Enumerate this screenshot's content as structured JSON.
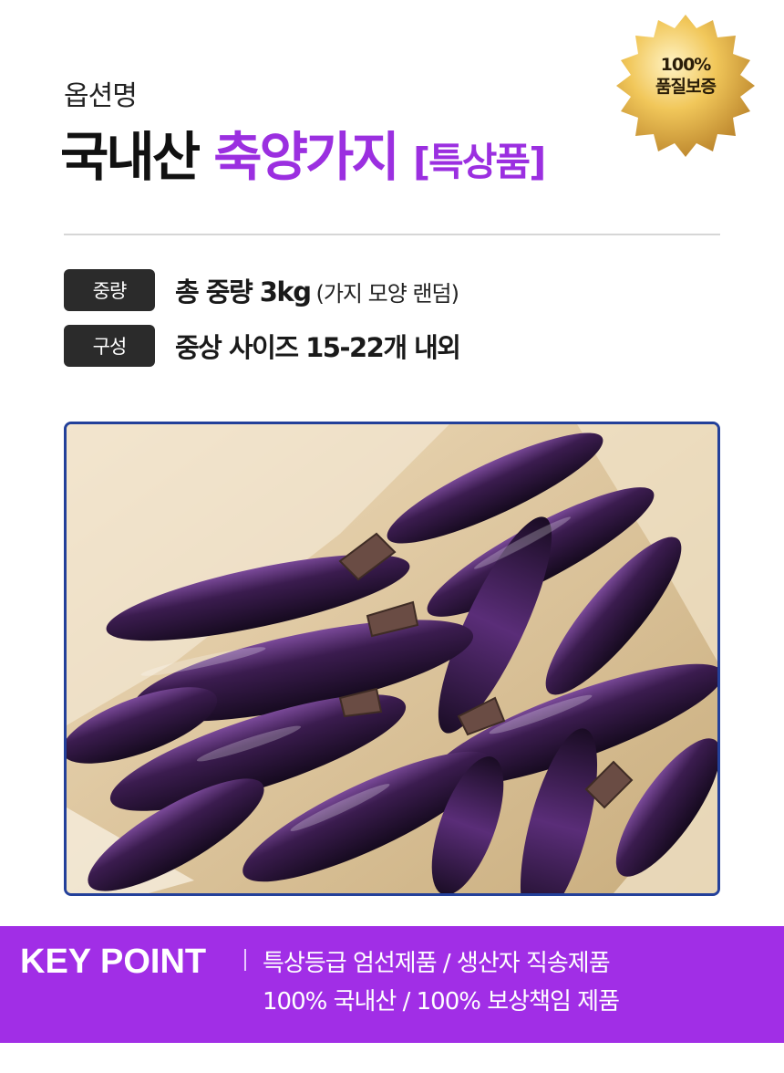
{
  "header": {
    "option_label": "옵션명",
    "title_origin": "국내산",
    "title_name": "축양가지",
    "title_grade": "[특상품]"
  },
  "badge": {
    "line1": "100%",
    "line2": "품질보증",
    "icon": "gold-seal-icon"
  },
  "specs": [
    {
      "tag": "중량",
      "value": "총 중량 3kg",
      "note": "(가지 모양 랜덤)"
    },
    {
      "tag": "구성",
      "value": "중상 사이즈 15-22개 내외",
      "note": ""
    }
  ],
  "photo": {
    "subject": "eggplant-box-photo"
  },
  "key_point": {
    "title": "KEY POINT",
    "line1": "특상등급 엄선제품 / 생산자 직송제품",
    "line2": "100% 국내산 / 100% 보상책임 제품"
  },
  "colors": {
    "accent": "#9b2fe0",
    "keypoint_bg": "#a12ee6",
    "tag_bg": "#2b2b2b",
    "photo_border": "#23409a",
    "badge_gold": "#e8b53a"
  }
}
